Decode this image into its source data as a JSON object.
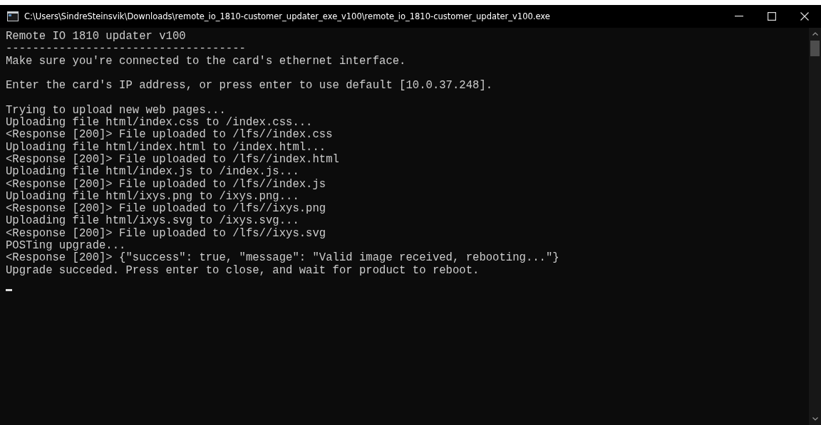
{
  "window": {
    "title": "C:\\Users\\SindreSteinsvik\\Downloads\\remote_io_1810-customer_updater_exe_v100\\remote_io_1810-customer_updater_v100.exe"
  },
  "console": {
    "blocks": [
      [
        "Remote IO 1810 updater v100",
        "------------------------------------",
        "Make sure you're connected to the card's ethernet interface."
      ],
      [
        "Enter the card's IP address, or press enter to use default [10.0.37.248]."
      ],
      [
        "Trying to upload new web pages...",
        "Uploading file html/index.css to /index.css...",
        "<Response [200]> File uploaded to /lfs//index.css",
        "Uploading file html/index.html to /index.html...",
        "<Response [200]> File uploaded to /lfs//index.html",
        "Uploading file html/index.js to /index.js...",
        "<Response [200]> File uploaded to /lfs//index.js",
        "Uploading file html/ixys.png to /ixys.png...",
        "<Response [200]> File uploaded to /lfs//ixys.png",
        "Uploading file html/ixys.svg to /ixys.svg...",
        "<Response [200]> File uploaded to /lfs//ixys.svg",
        "POSTing upgrade...",
        "<Response [200]> {\"success\": true, \"message\": \"Valid image received, rebooting...\"}",
        "Upgrade succeded. Press enter to close, and wait for product to reboot."
      ]
    ]
  }
}
